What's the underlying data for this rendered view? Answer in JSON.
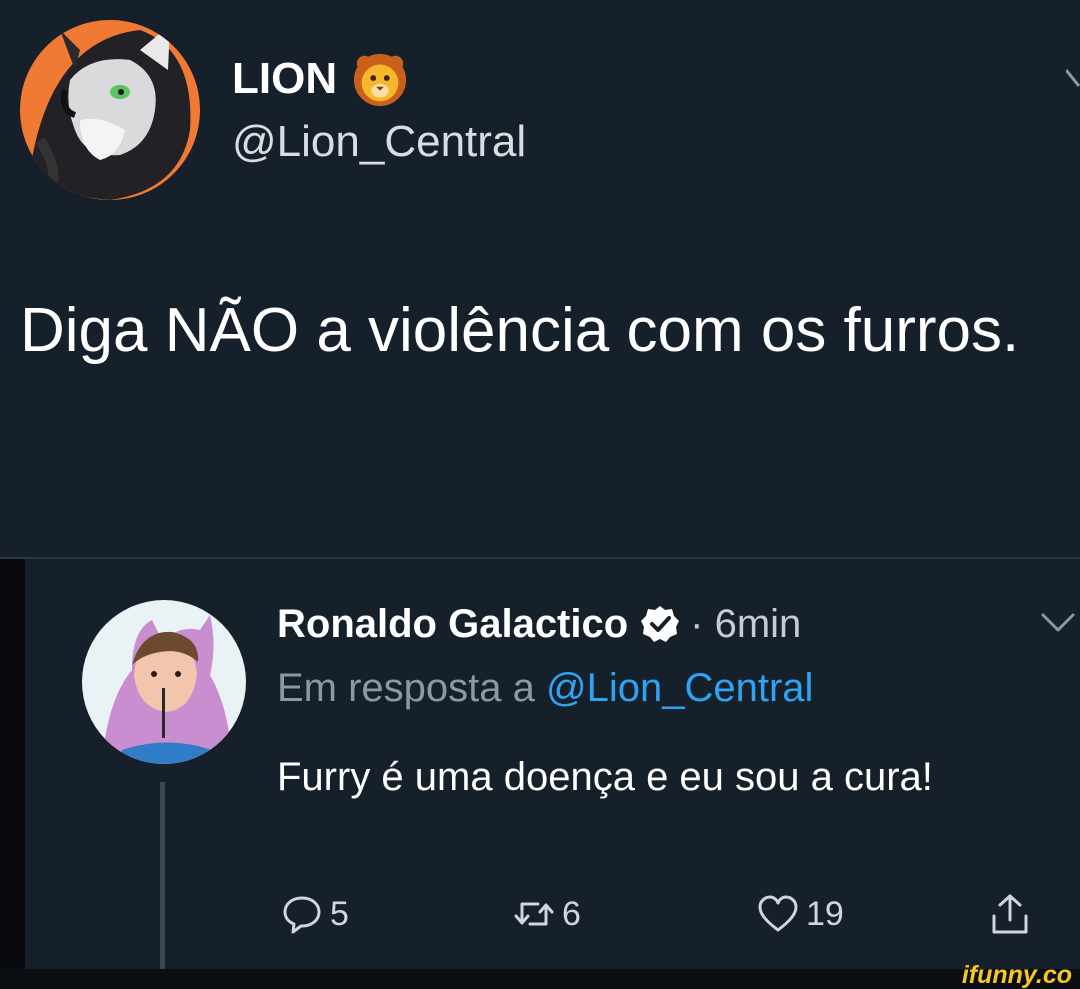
{
  "tweet": {
    "author_name": "LION",
    "author_emoji": "lion-emoji",
    "author_handle": "@Lion_Central",
    "text": "Diga NÃO a violência com os furros."
  },
  "reply": {
    "author_name": "Ronaldo Galactico",
    "verified": true,
    "time": "· 6min",
    "reply_to_prefix": "Em resposta a ",
    "reply_to_handle": "@Lion_Central",
    "text": "Furry é uma doença e eu sou a cura!",
    "actions": {
      "reply_count": "5",
      "retweet_count": "6",
      "like_count": "19"
    }
  },
  "watermark": "ifunny.co",
  "colors": {
    "background": "#16202b",
    "mention": "#2fa3f3",
    "watermark": "#f6c722"
  }
}
